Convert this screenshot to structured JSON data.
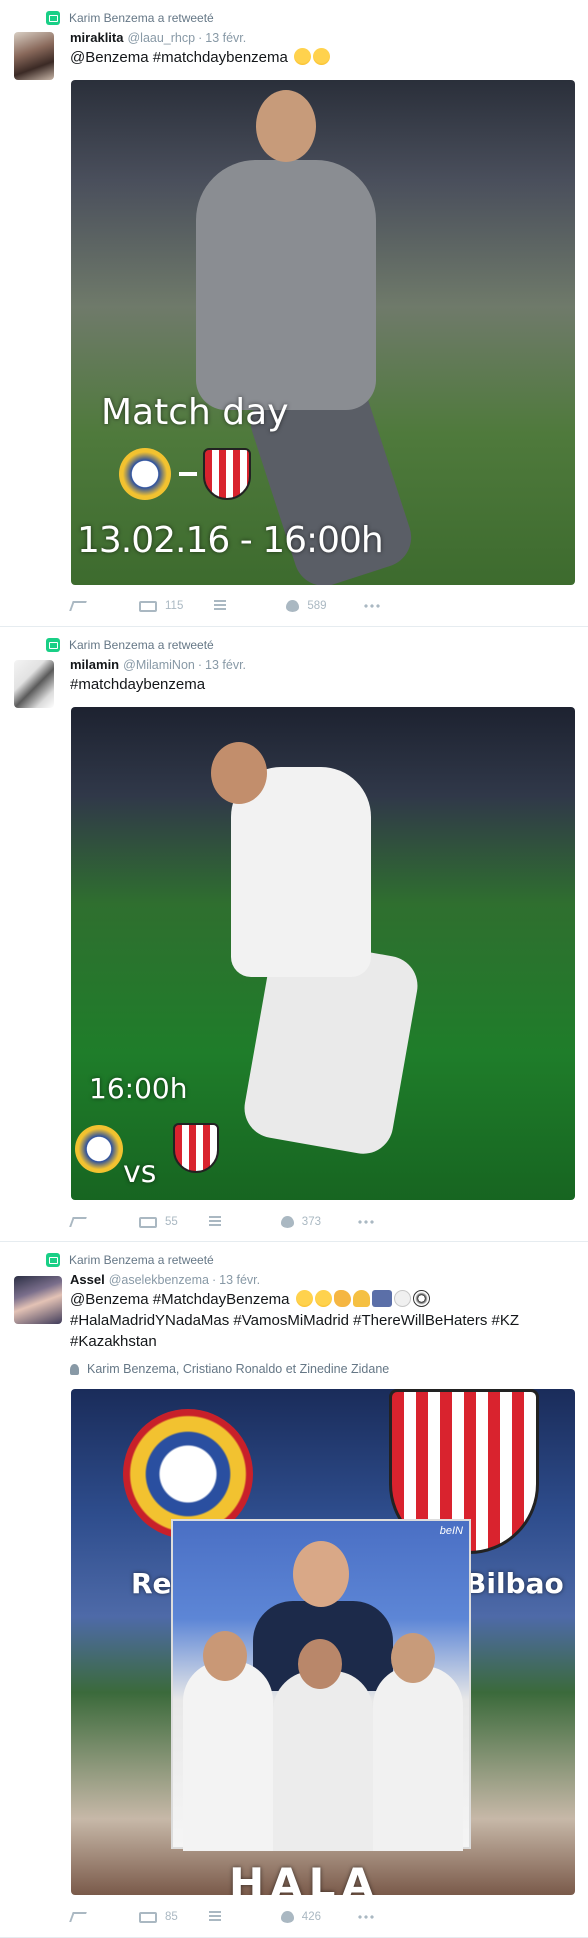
{
  "tweets": [
    {
      "retweeted_by": "Karim Benzema a retweeté",
      "name": "miraklita",
      "handle": "@laau_rhcp",
      "date": "13 févr.",
      "text": "@Benzema #matchdaybenzema",
      "media_text": {
        "match": "Match day",
        "datetime": "13.02.16 - 16:00h"
      },
      "retweets": "115",
      "likes": "589"
    },
    {
      "retweeted_by": "Karim Benzema a retweeté",
      "name": "milamin",
      "handle": "@MilamiNon",
      "date": "13 févr.",
      "text": "#matchdaybenzema",
      "media_text": {
        "time": "16:00h",
        "vs": "vs"
      },
      "retweets": "55",
      "likes": "373"
    },
    {
      "retweeted_by": "Karim Benzema a retweeté",
      "name": "Assel",
      "handle": "@aselekbenzema",
      "date": "13 févr.",
      "text_lines": [
        "@Benzema #MatchdayBenzema",
        "#HalaMadridYNadaMas #VamosMiMadrid #ThereWillBeHaters #KZ",
        "#Kazakhstan"
      ],
      "mentions": "Karim Benzema, Cristiano Ronaldo et Zinedine Zidane",
      "media_text": {
        "left": "Real",
        "right": "Bilbao",
        "bottom": "HALA",
        "logo": "beIN"
      },
      "retweets": "85",
      "likes": "426"
    }
  ],
  "icons": {
    "retweet_badge": "retweet-icon",
    "reply": "reply-icon",
    "retweet": "retweet-icon",
    "collection": "stack-icon",
    "like": "heart-icon",
    "more": "more-icon",
    "people": "person-icon"
  },
  "colors": {
    "retweet_badge": "#19cf86",
    "meta_text": "#657786",
    "action_icon": "#aab8c2",
    "separator": "#e6ecf0"
  }
}
